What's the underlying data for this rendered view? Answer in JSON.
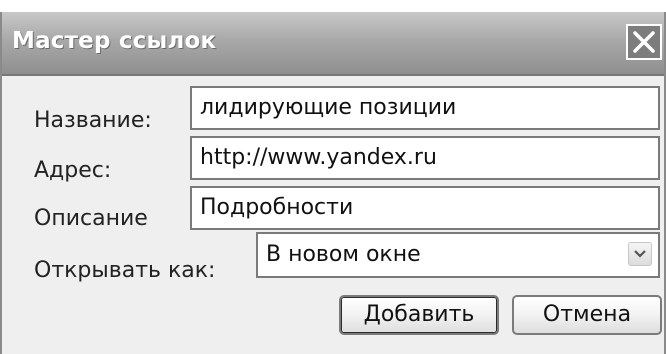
{
  "dialog": {
    "title": "Мастер ссылок",
    "close_icon": "close-icon"
  },
  "form": {
    "name_label": "Название:",
    "name_value": "лидирующие позиции",
    "address_label": "Адрес:",
    "address_value": "http://www.yandex.ru",
    "description_label": "Описание",
    "description_value": "Подробности",
    "open_as_label": "Открывать как:",
    "open_as_value": "В новом окне",
    "dropdown_icon": "chevron-down-icon"
  },
  "buttons": {
    "add_label": "Добавить",
    "cancel_label": "Отмена"
  }
}
